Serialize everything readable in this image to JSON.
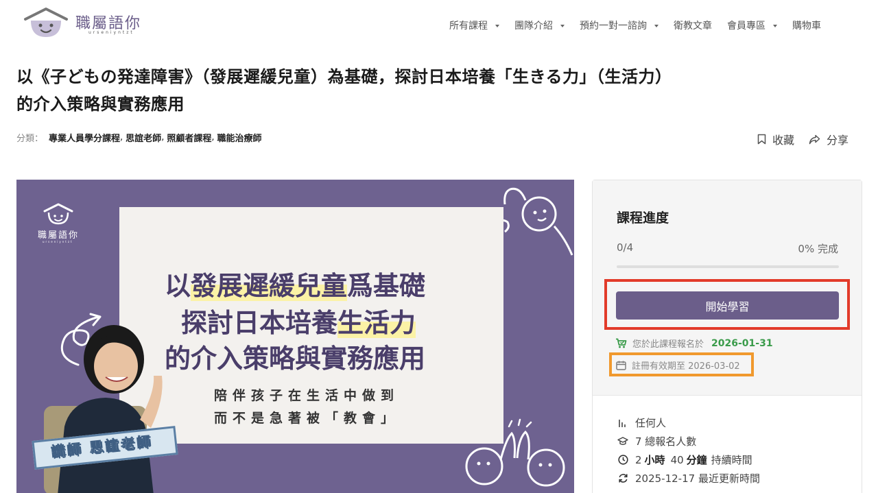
{
  "brand": {
    "name": "職屬語你",
    "subtitle": "urseniyntzt"
  },
  "nav": {
    "items": [
      {
        "label": "所有課程",
        "dropdown": true
      },
      {
        "label": "團隊介紹",
        "dropdown": true
      },
      {
        "label": "預約一對一諮詢",
        "dropdown": true
      },
      {
        "label": "衛教文章",
        "dropdown": false
      },
      {
        "label": "會員專區",
        "dropdown": true
      },
      {
        "label": "購物車",
        "dropdown": false
      }
    ]
  },
  "course": {
    "title": "以《子どもの発達障害》（發展遲緩兒童）為基礎，探討日本培養「生きる力」（生活力）的介入策略與實務應用",
    "category_label": "分類：",
    "categories": [
      "專業人員學分課程",
      "思誼老師",
      "照顧者課程",
      "職能治療師"
    ]
  },
  "actions": {
    "bookmark": "收藏",
    "share": "分享"
  },
  "banner": {
    "logo_name": "職屬語你",
    "logo_sub": "urseniyntzt",
    "line1_a": "以",
    "line1_hl": "發展遲緩兒童",
    "line1_b": "爲基礎",
    "line2_a": "探討日本培養",
    "line2_hl": "生活力",
    "line3": "的介入策略與實務應用",
    "sub1": "陪伴孩子在生活中做到",
    "sub2": "而不是急著被「教會」",
    "instructor": "講師 思誼老師"
  },
  "progress": {
    "title": "課程進度",
    "count": "0/4",
    "percent_text": "0% 完成",
    "fraction": 0,
    "start_button": "開始學習",
    "enroll_label": "您於此課程報名於",
    "enroll_date": "2026-01-31",
    "expiry_text": "註冊有效期至 2026-03-02"
  },
  "info": {
    "level": "任何人",
    "enrolled": "7 總報名人數",
    "duration_hours": "2",
    "duration_hours_unit": "小時",
    "duration_minutes": "40",
    "duration_minutes_unit": "分鐘",
    "duration_suffix": "持續時間",
    "updated": "2025-12-17 最近更新時間"
  },
  "colors": {
    "brand_purple": "#6b5e8a",
    "success_green": "#3a9b4a",
    "highlight_red": "#e23b2a",
    "highlight_orange": "#f0992e"
  }
}
